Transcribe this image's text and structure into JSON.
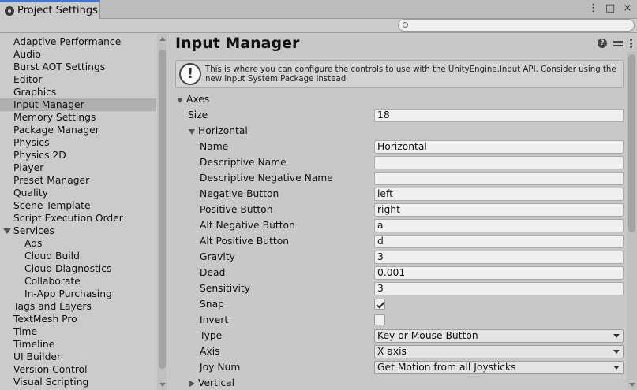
{
  "window": {
    "tab_title": "Project Settings",
    "controls": [
      "⋮",
      "□",
      "×"
    ]
  },
  "search": {
    "placeholder": ""
  },
  "sidebar": {
    "items": [
      {
        "label": "Adaptive Performance"
      },
      {
        "label": "Audio"
      },
      {
        "label": "Burst AOT Settings"
      },
      {
        "label": "Editor"
      },
      {
        "label": "Graphics"
      },
      {
        "label": "Input Manager",
        "selected": true
      },
      {
        "label": "Memory Settings"
      },
      {
        "label": "Package Manager"
      },
      {
        "label": "Physics"
      },
      {
        "label": "Physics 2D"
      },
      {
        "label": "Player"
      },
      {
        "label": "Preset Manager"
      },
      {
        "label": "Quality"
      },
      {
        "label": "Scene Template"
      },
      {
        "label": "Script Execution Order"
      },
      {
        "label": "Services",
        "expandable": true
      },
      {
        "label": "Ads",
        "sub": true
      },
      {
        "label": "Cloud Build",
        "sub": true
      },
      {
        "label": "Cloud Diagnostics",
        "sub": true
      },
      {
        "label": "Collaborate",
        "sub": true
      },
      {
        "label": "In-App Purchasing",
        "sub": true
      },
      {
        "label": "Tags and Layers"
      },
      {
        "label": "TextMesh Pro"
      },
      {
        "label": "Time"
      },
      {
        "label": "Timeline"
      },
      {
        "label": "UI Builder"
      },
      {
        "label": "Version Control"
      },
      {
        "label": "Visual Scripting"
      }
    ]
  },
  "main": {
    "title": "Input Manager",
    "info_text": "This is where you can configure the controls to use with the UnityEngine.Input API. Consider using the new Input System Package instead.",
    "axes_label": "Axes",
    "size_label": "Size",
    "size_value": "18",
    "axis_name": "Horizontal",
    "fields": {
      "name": {
        "label": "Name",
        "value": "Horizontal"
      },
      "descriptive_name": {
        "label": "Descriptive Name",
        "value": ""
      },
      "descriptive_negative_name": {
        "label": "Descriptive Negative Name",
        "value": ""
      },
      "negative_button": {
        "label": "Negative Button",
        "value": "left"
      },
      "positive_button": {
        "label": "Positive Button",
        "value": "right"
      },
      "alt_negative_button": {
        "label": "Alt Negative Button",
        "value": "a"
      },
      "alt_positive_button": {
        "label": "Alt Positive Button",
        "value": "d"
      },
      "gravity": {
        "label": "Gravity",
        "value": "3"
      },
      "dead": {
        "label": "Dead",
        "value": "0.001"
      },
      "sensitivity": {
        "label": "Sensitivity",
        "value": "3"
      },
      "snap": {
        "label": "Snap",
        "checked": true
      },
      "invert": {
        "label": "Invert",
        "checked": false
      },
      "type": {
        "label": "Type",
        "value": "Key or Mouse Button"
      },
      "axis": {
        "label": "Axis",
        "value": "X axis"
      },
      "joy_num": {
        "label": "Joy Num",
        "value": "Get Motion from all Joysticks"
      }
    },
    "next_axis": "Vertical"
  }
}
